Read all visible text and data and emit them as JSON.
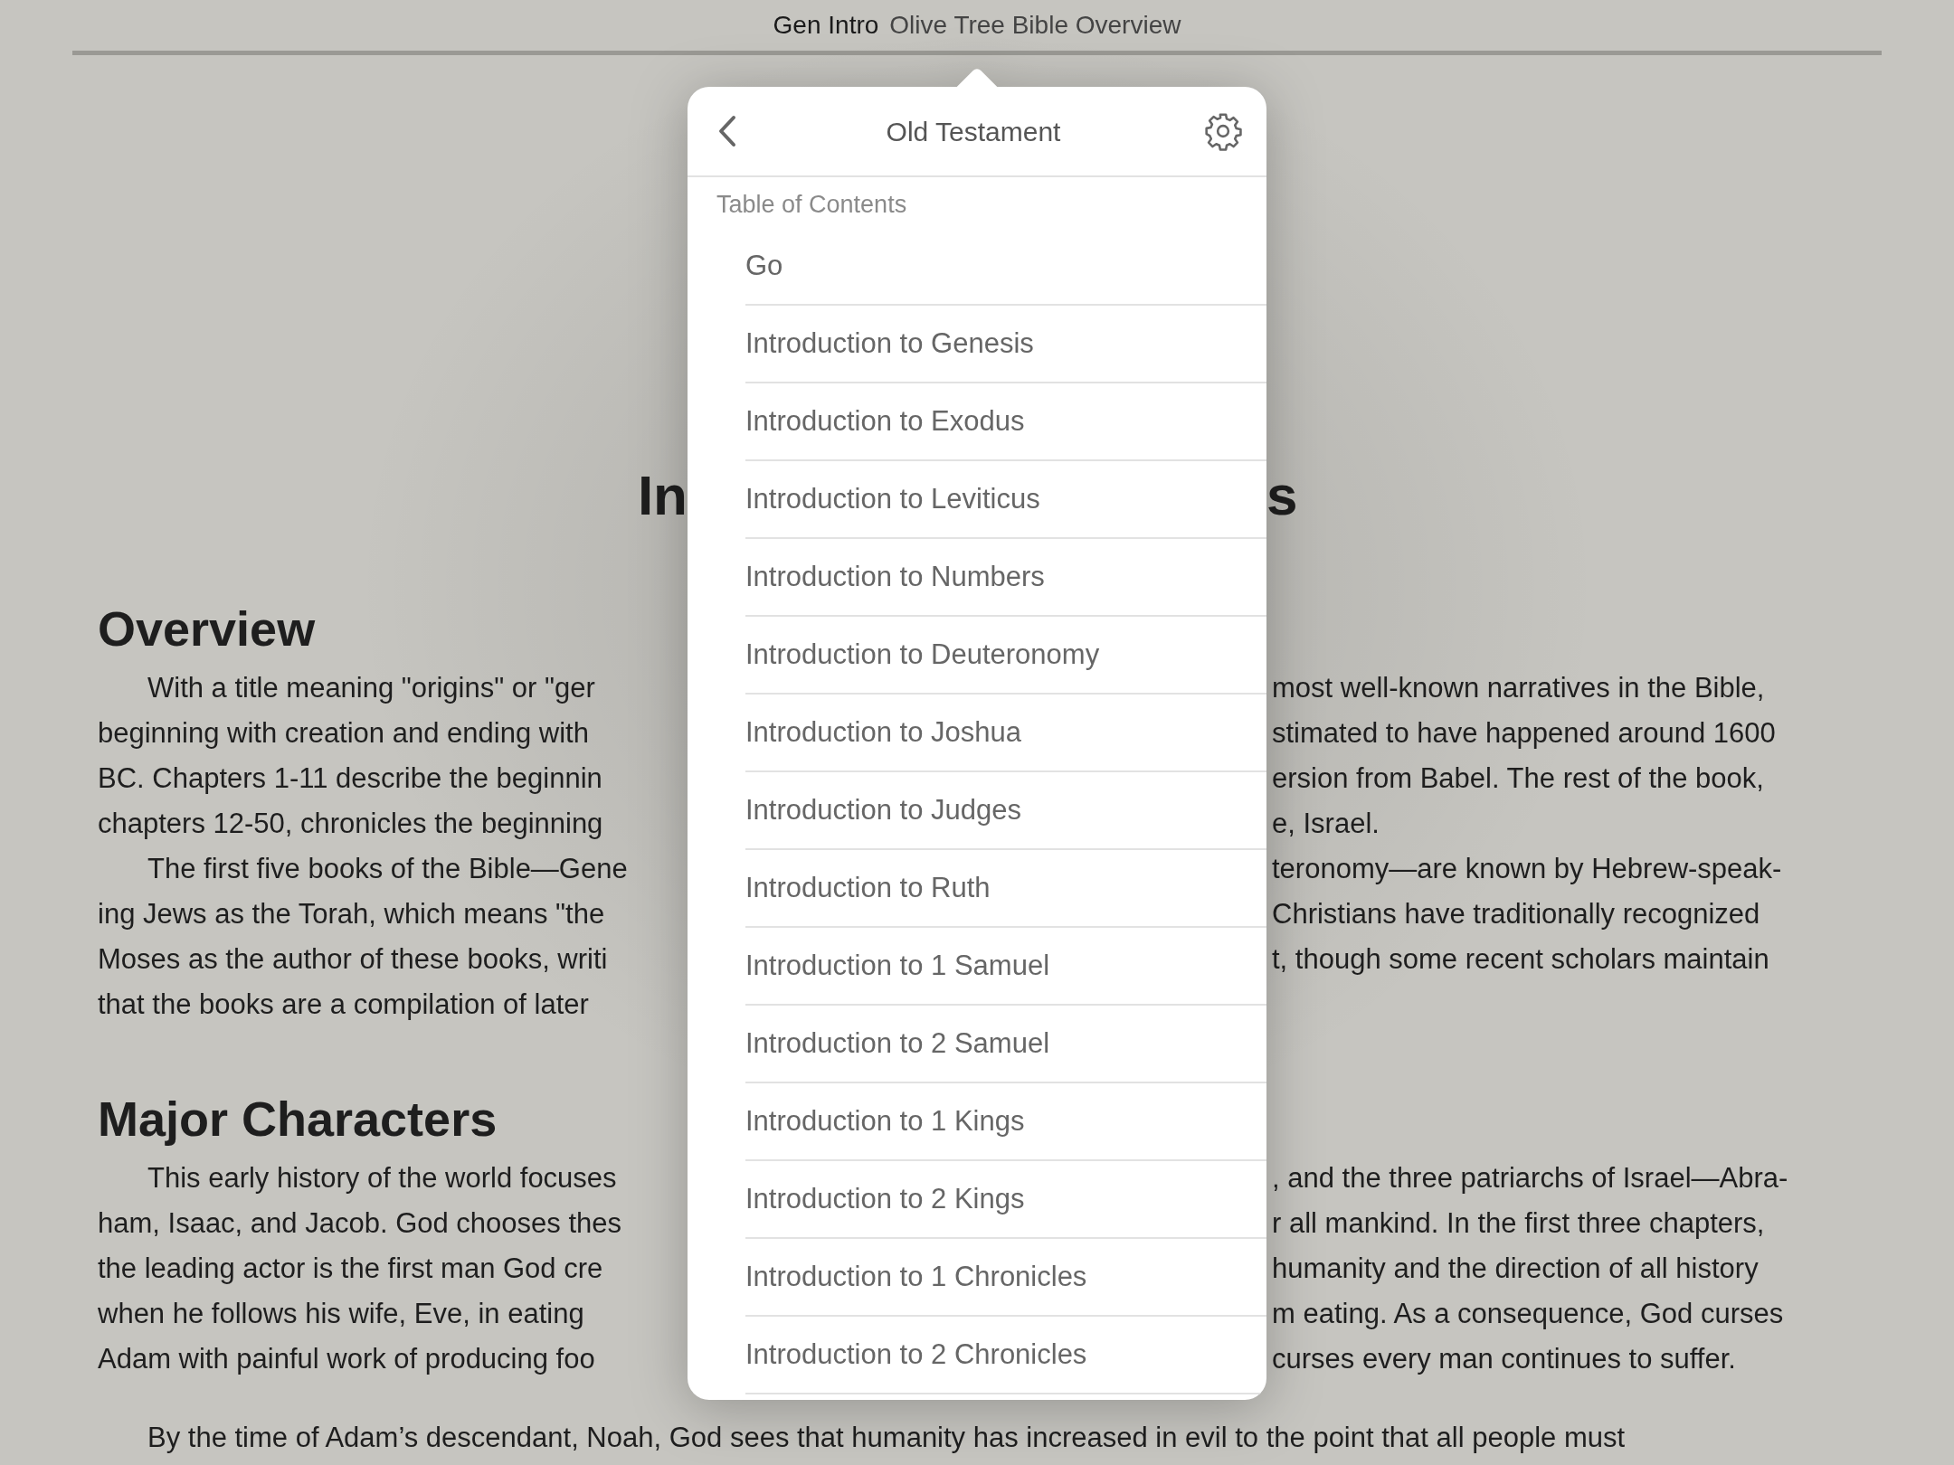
{
  "header": {
    "book": "Gen Intro",
    "title": "Olive Tree Bible Overview"
  },
  "page_title": {
    "left": "In",
    "right": "s"
  },
  "sections": [
    {
      "heading": "Overview",
      "paragraphs": [
        {
          "lines": [
            {
              "left": "With a title meaning \"origins\" or \"ger",
              "right": "most well-known narratives in the Bible,"
            },
            {
              "left": "beginning with creation and ending with",
              "right": "stimated to have happened around 1600"
            },
            {
              "left": "BC. Chapters 1-11 describe the beginnin",
              "right": "ersion from Babel. The rest of the book,"
            },
            {
              "left": "chapters 12-50, chronicles the beginning",
              "right": "e, Israel."
            }
          ]
        },
        {
          "lines": [
            {
              "left": "The first five books of the Bible—Gene",
              "right": "teronomy—are known by Hebrew-speak-"
            },
            {
              "left": "ing Jews as the Torah, which means \"the",
              "right": "Christians have traditionally recognized"
            },
            {
              "left": "Moses as the author of these books, writi",
              "right": "t, though some recent scholars maintain"
            },
            {
              "left": "that the books are a compilation of later"
            }
          ]
        }
      ]
    },
    {
      "heading": "Major Characters",
      "paragraphs": [
        {
          "lines": [
            {
              "left": "This early history of the world focuses",
              "right": ", and the three patriarchs of Israel—Abra-"
            },
            {
              "left": "ham, Isaac, and Jacob. God chooses thes",
              "right": "r all mankind. In the first three chapters,"
            },
            {
              "left": "the leading actor is the first man God cre",
              "right": "humanity and the direction of all history"
            },
            {
              "left": "when he follows his wife, Eve, in eating",
              "right": "m eating. As a consequence, God curses"
            },
            {
              "left": "Adam with painful work of producing foo",
              "right": "curses every man continues to suffer."
            }
          ]
        }
      ]
    }
  ],
  "bottom_line": "By the time of Adam’s descendant, Noah, God sees that humanity has increased in evil to the point that all people must",
  "popover": {
    "title": "Old Testament",
    "section_label": "Table of Contents",
    "items": [
      "Go",
      "Introduction to Genesis",
      "Introduction to Exodus",
      "Introduction to Leviticus",
      "Introduction to Numbers",
      "Introduction to Deuteronomy",
      "Introduction to Joshua",
      "Introduction to Judges",
      "Introduction to Ruth",
      "Introduction to 1 Samuel",
      "Introduction to 2 Samuel",
      "Introduction to 1 Kings",
      "Introduction to 2 Kings",
      "Introduction to 1 Chronicles",
      "Introduction to 2 Chronicles"
    ]
  }
}
